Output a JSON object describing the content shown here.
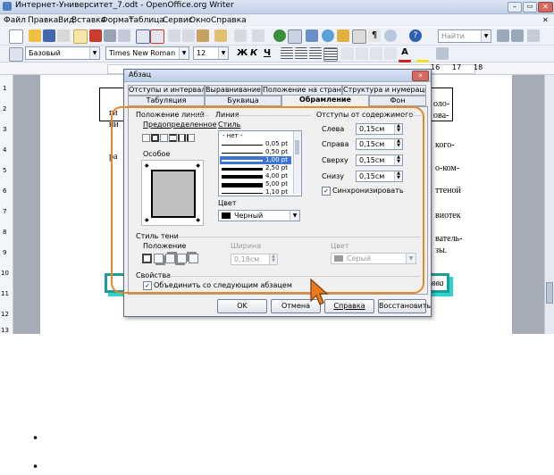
{
  "window": {
    "title": "Интернет-Университет_7.odt - OpenOffice.org Writer"
  },
  "menu": [
    "Файл",
    "Правка",
    "Вид",
    "Вставка",
    "Формат",
    "Таблица",
    "Сервис",
    "Окно",
    "Справка"
  ],
  "toolbar": {
    "find_placeholder": "Найти"
  },
  "format_toolbar": {
    "style": "Базовый",
    "font": "Times New Roman",
    "size": "12",
    "bold": "Ж",
    "italic": "К",
    "underline": "Ч"
  },
  "ruler": {
    "numbers": [
      "16",
      "17",
      "18"
    ]
  },
  "vertical_ruler": [
    "1",
    "2",
    "3",
    "4",
    "5",
    "6",
    "7",
    "8",
    "9",
    "10",
    "11",
    "12",
    "13"
  ],
  "document": {
    "left_frags": [
      "ги",
      "ни",
      "ра",
      "",
      "",
      "",
      "",
      "",
      ""
    ],
    "right_frags": [
      "оло-",
      "ова-",
      "кого-",
      "о-ком-",
      "ттеной",
      "виотек",
      "ватель-",
      "зы.",
      ""
    ],
    "caption": "вва"
  },
  "dialog": {
    "title": "Абзац",
    "tabs_row1": [
      "Отступы и интервалы",
      "Выравнивание",
      "Положение на странице",
      "Структура и нумерация"
    ],
    "tabs_row2": [
      "Табуляция",
      "Буквица",
      "Обрамление",
      "Фон"
    ],
    "active_tab": "Обрамление",
    "line_position": {
      "group": "Положение линий",
      "predefined": "Предопределенное",
      "custom": "Особое"
    },
    "line": {
      "group": "Линия",
      "style_label": "Стиль",
      "styles": [
        {
          "label": "- нет -"
        },
        {
          "label": "0,05 pt",
          "w": 0.5
        },
        {
          "label": "0,50 pt",
          "w": 1
        },
        {
          "label": "1,00 pt",
          "w": 2,
          "selected": true
        },
        {
          "label": "2,50 pt",
          "w": 3
        },
        {
          "label": "4,00 pt",
          "w": 4
        },
        {
          "label": "5,00 pt",
          "w": 5
        },
        {
          "label": "1,10 pt",
          "w": 1
        }
      ],
      "color_label": "Цвет",
      "color_value": "Черный"
    },
    "spacing": {
      "group": "Отступы от содержимого",
      "left_label": "Слева",
      "left_value": "0,15см",
      "right_label": "Справа",
      "right_value": "0,15см",
      "top_label": "Сверху",
      "top_value": "0,15см",
      "bottom_label": "Снизу",
      "bottom_value": "0,15см",
      "sync_label": "Синхронизировать"
    },
    "shadow": {
      "group": "Стиль тени",
      "position_label": "Положение",
      "width_label": "Ширина",
      "width_value": "0,18см",
      "color_label": "Цвет",
      "color_value": "Серый"
    },
    "properties": {
      "group": "Свойства",
      "merge_label": "Объединить со следующим абзацем"
    },
    "buttons": {
      "ok": "OK",
      "cancel": "Отмена",
      "help": "Справка",
      "reset": "Восстановить"
    }
  },
  "page_bullets": [
    "•",
    "•"
  ],
  "colors": {
    "highlight_orange": "#e8862a",
    "titlebar": "#c5d3e6",
    "accent_teal": "#1a9e98",
    "selected_blue": "#3c74d6"
  }
}
